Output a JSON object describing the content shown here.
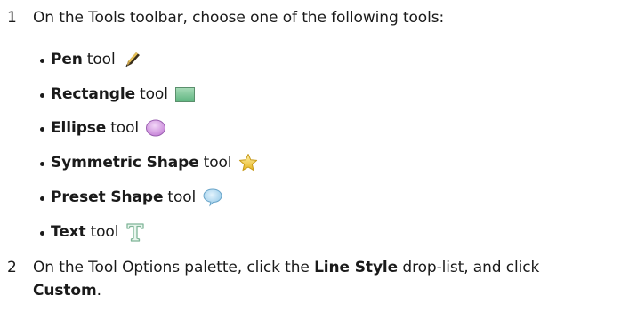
{
  "steps": [
    {
      "number": "1",
      "text": "On the Tools toolbar, choose one of the following tools:",
      "tools": [
        {
          "name": "Pen",
          "suffix": "tool",
          "icon": "pen-icon"
        },
        {
          "name": "Rectangle",
          "suffix": "tool",
          "icon": "rectangle-icon"
        },
        {
          "name": "Ellipse",
          "suffix": "tool",
          "icon": "ellipse-icon"
        },
        {
          "name": "Symmetric Shape",
          "suffix": "tool",
          "icon": "star-icon"
        },
        {
          "name": "Preset Shape",
          "suffix": "tool",
          "icon": "speech-bubble-icon"
        },
        {
          "name": "Text",
          "suffix": "tool",
          "icon": "text-t-icon"
        }
      ]
    },
    {
      "number": "2",
      "text_parts": {
        "a": "On the Tool Options palette, click the ",
        "b": "Line Style",
        "c": " drop-list, and click",
        "d": "Custom",
        "e": "."
      }
    }
  ],
  "colors": {
    "text": "#1a1a1a",
    "rectangle_fill": "#7cc79a",
    "ellipse_fill": "#d9a6e6",
    "star_fill": "#f3cf3a",
    "bubble_fill": "#a9d4ee",
    "text_icon": "#9acbb0"
  }
}
